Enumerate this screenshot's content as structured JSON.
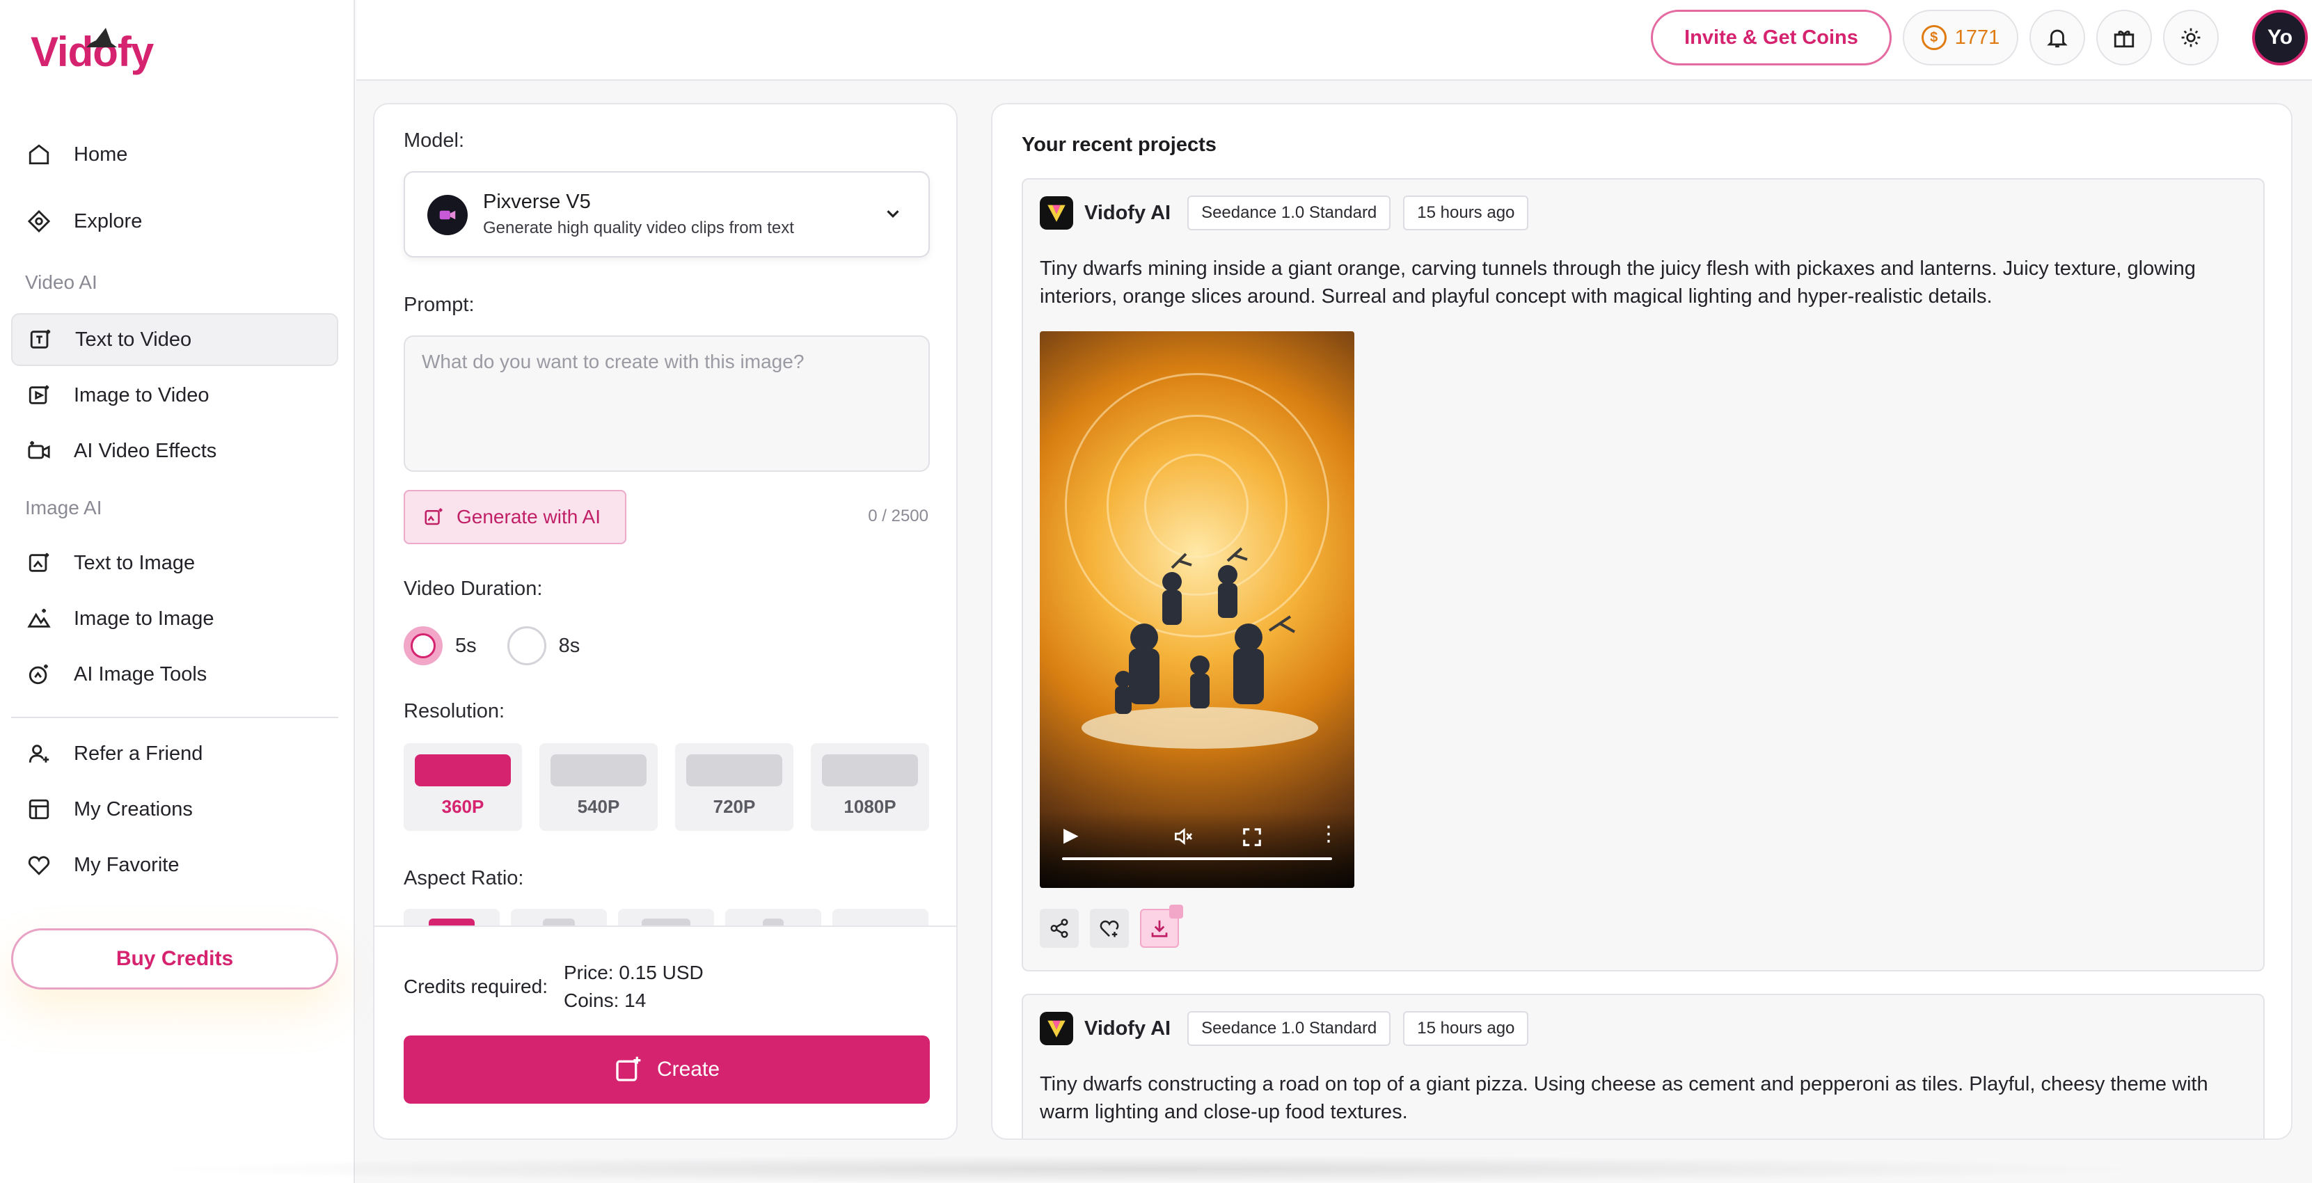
{
  "app": {
    "logo_text": "Vidofy"
  },
  "sidebar": {
    "items": [
      {
        "label": "Home",
        "icon": "home-icon"
      },
      {
        "label": "Explore",
        "icon": "explore-icon"
      },
      {
        "label": "Text to Video",
        "icon": "text-to-video-icon",
        "active": true
      },
      {
        "label": "Image to Video",
        "icon": "image-to-video-icon"
      },
      {
        "label": "AI Video Effects",
        "icon": "video-effects-icon"
      },
      {
        "label": "Text to Image",
        "icon": "text-to-image-icon"
      },
      {
        "label": "Image to Image",
        "icon": "image-to-image-icon"
      },
      {
        "label": "AI Image Tools",
        "icon": "image-tools-icon"
      },
      {
        "label": "Refer a Friend",
        "icon": "refer-friend-icon"
      },
      {
        "label": "My Creations",
        "icon": "creations-icon"
      },
      {
        "label": "My Favorite",
        "icon": "heart-icon"
      }
    ],
    "sections": {
      "video_ai": "Video AI",
      "image_ai": "Image AI"
    },
    "buy_credits": "Buy Credits"
  },
  "topbar": {
    "invite": "Invite & Get Coins",
    "coins": "1771",
    "coin_symbol": "$",
    "avatar": "Yo"
  },
  "form": {
    "model_label": "Model:",
    "model_name": "Pixverse V5",
    "model_desc": "Generate high quality video clips from text",
    "prompt_label": "Prompt:",
    "prompt_placeholder": "What do you want to create with this image?",
    "prompt_value": "",
    "generate_ai": "Generate with AI",
    "char_count": "0 / 2500",
    "duration_label": "Video Duration:",
    "durations": [
      {
        "label": "5s",
        "selected": true
      },
      {
        "label": "8s",
        "selected": false
      }
    ],
    "resolution_label": "Resolution:",
    "resolutions": [
      {
        "label": "360P",
        "selected": true
      },
      {
        "label": "540P",
        "selected": false
      },
      {
        "label": "720P",
        "selected": false
      },
      {
        "label": "1080P",
        "selected": false
      }
    ],
    "aspect_label": "Aspect Ratio:",
    "credits_label": "Credits required:",
    "price": "Price: 0.15 USD",
    "coins": "Coins: 14",
    "create": "Create"
  },
  "projects": {
    "title": "Your recent projects",
    "items": [
      {
        "author": "Vidofy AI",
        "model": "Seedance 1.0 Standard",
        "time": "15 hours ago",
        "prompt": "Tiny dwarfs mining inside a giant orange, carving tunnels through the juicy flesh with pickaxes and lanterns. Juicy texture, glowing interiors, orange slices around. Surreal and playful concept with magical lighting and hyper-realistic details."
      },
      {
        "author": "Vidofy AI",
        "model": "Seedance 1.0 Standard",
        "time": "15 hours ago",
        "prompt": "Tiny dwarfs constructing a road on top of a giant pizza. Using cheese as cement and pepperoni as tiles. Playful, cheesy theme with warm lighting and close-up food textures."
      }
    ]
  },
  "colors": {
    "accent": "#d6236f",
    "coin": "#e07b12"
  }
}
